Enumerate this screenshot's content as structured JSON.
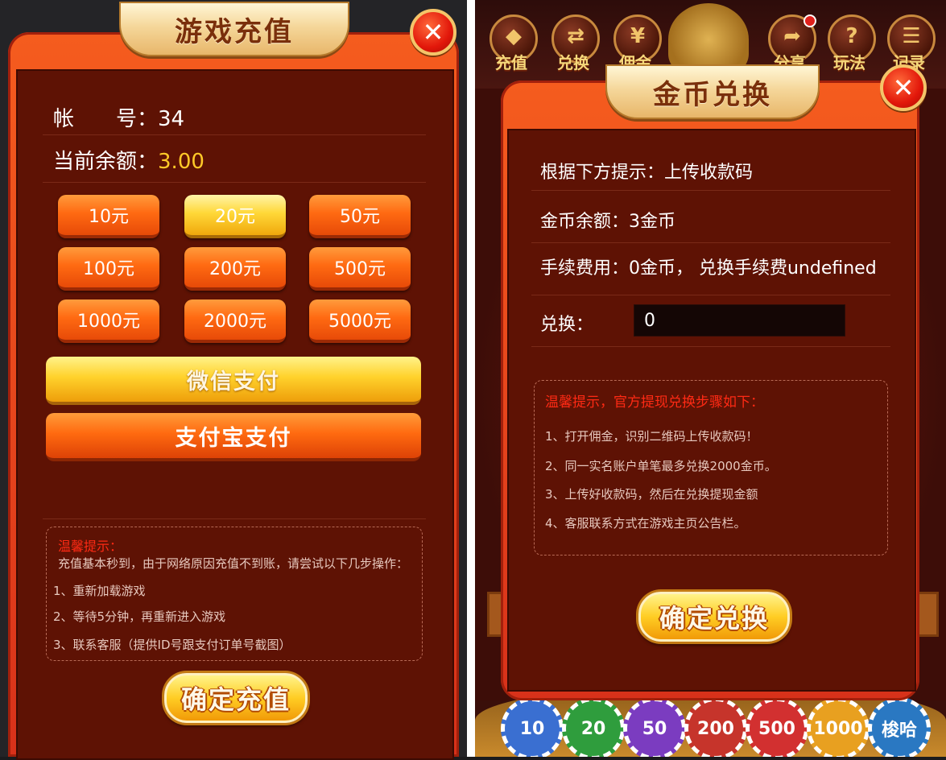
{
  "left": {
    "title": "游戏充值",
    "close_glyph": "✕",
    "account_label": "帐　　号：",
    "account_value": "34",
    "balance_label": "当前余额：",
    "balance_value": "3.00",
    "amounts": [
      "10元",
      "20元",
      "50元",
      "100元",
      "200元",
      "500元",
      "1000元",
      "2000元",
      "5000元"
    ],
    "selected_amount": "20元",
    "pay_wechat": "微信支付",
    "pay_alipay": "支付宝支付",
    "tips": {
      "title": "温馨提示：",
      "intro": "充值基本秒到，由于网络原因充值不到账，请尝试以下几步操作：",
      "items": [
        "1、重新加载游戏",
        "2、等待5分钟，再重新进入游戏",
        "3、联系客服（提供ID号跟支付订单号截图）"
      ]
    },
    "confirm": "确定充值"
  },
  "right": {
    "top_icons": [
      {
        "icon": "gem-chest-icon",
        "glyph": "◆",
        "label": "充值"
      },
      {
        "icon": "exchange-icon",
        "glyph": "⇄",
        "label": "兑换"
      },
      {
        "icon": "money-bag-icon",
        "glyph": "¥",
        "label": "佣金"
      },
      {
        "icon": "share-icon",
        "glyph": "➦",
        "label": "分享"
      },
      {
        "icon": "help-icon",
        "glyph": "?",
        "label": "玩法"
      },
      {
        "icon": "record-icon",
        "glyph": "☰",
        "label": "记录"
      }
    ],
    "title": "金币兑换",
    "close_glyph": "✕",
    "hint_line": "根据下方提示：上传收款码",
    "balance_line": "金币余额：3金币",
    "fee_line": "手续费用：0金币， 兑换手续费undefined",
    "exchange_label": "兑换：",
    "exchange_value": "0",
    "tips": {
      "title": "温馨提示，官方提现兑换步骤如下：",
      "items": [
        "1、打开佣金，识别二维码上传收款码！",
        "2、同一实名账户单笔最多兑换2000金币。",
        "3、上传好收款码，然后在兑换提现金额",
        "4、客服联系方式在游戏主页公告栏。"
      ]
    },
    "confirm": "确定兑换",
    "chips": [
      {
        "label": "10",
        "color": "#3a6fd1"
      },
      {
        "label": "20",
        "color": "#2f9d3d"
      },
      {
        "label": "50",
        "color": "#7b3cc0"
      },
      {
        "label": "200",
        "color": "#c6342b"
      },
      {
        "label": "500",
        "color": "#d23030"
      },
      {
        "label": "1000",
        "color": "#e8a020"
      },
      {
        "label": "梭哈",
        "color": "#2a78c2"
      }
    ]
  }
}
